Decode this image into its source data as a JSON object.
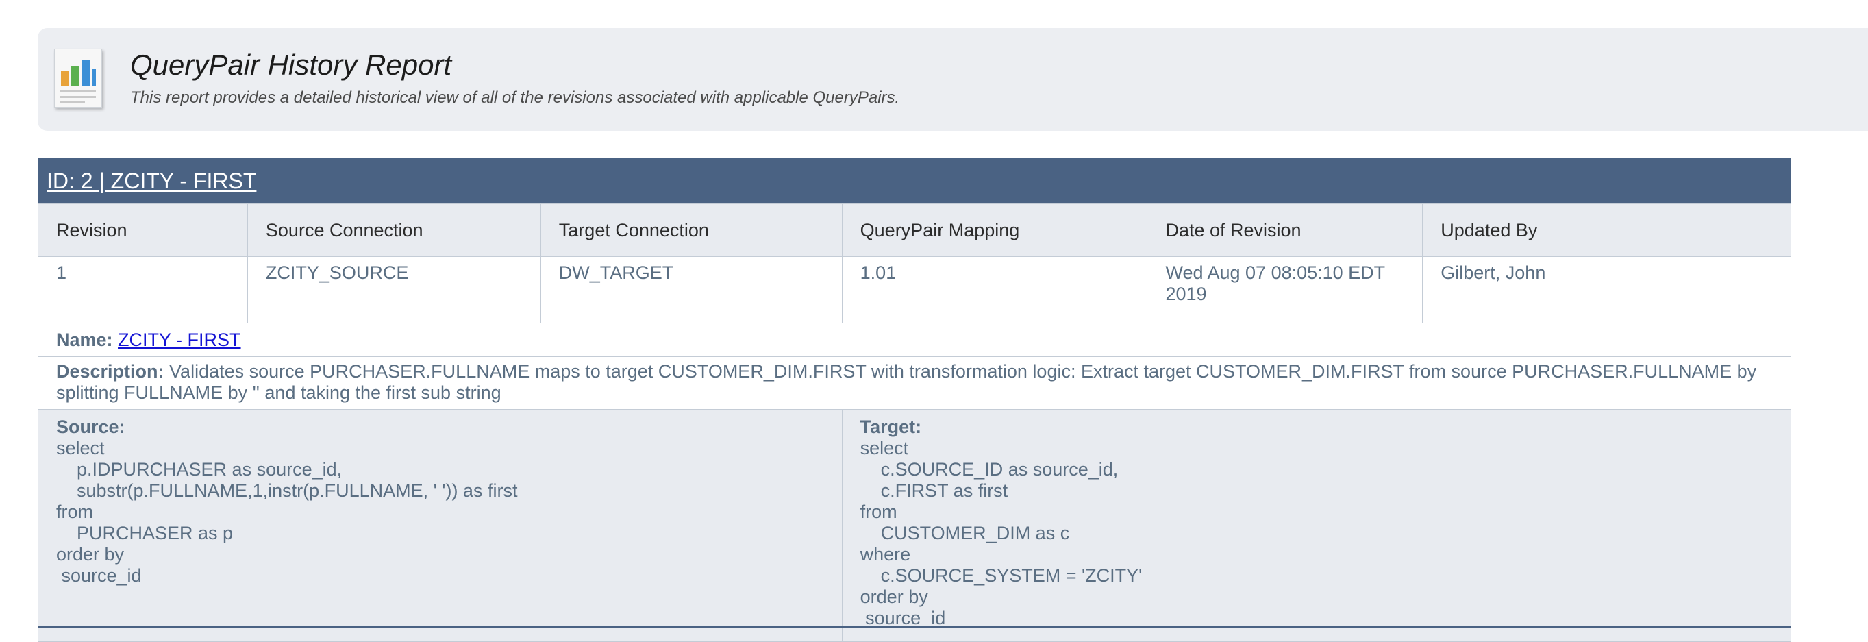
{
  "report": {
    "title": "QueryPair History Report",
    "subtitle": "This report provides a detailed historical view of all of the revisions associated with applicable QueryPairs."
  },
  "querypair": {
    "heading": "ID: 2 | ZCITY - FIRST",
    "columns": [
      "Revision",
      "Source Connection",
      "Target Connection",
      "QueryPair Mapping",
      "Date of Revision",
      "Updated By"
    ],
    "row": {
      "revision": "1",
      "source_connection": "ZCITY_SOURCE",
      "target_connection": "DW_TARGET",
      "mapping": "1.01",
      "date": "Wed Aug 07 08:05:10 EDT 2019",
      "updated_by": "Gilbert, John"
    },
    "name_label": "Name:",
    "name_value": "ZCITY - FIRST",
    "description_label": "Description:",
    "description_value": "Validates source PURCHASER.FULLNAME maps to target CUSTOMER_DIM.FIRST with transformation logic: Extract target CUSTOMER_DIM.FIRST from source PURCHASER.FULLNAME by splitting FULLNAME by '' and taking the first sub string",
    "source_label": "Source:",
    "source_sql": [
      "select",
      "    p.IDPURCHASER as source_id,",
      "    substr(p.FULLNAME,1,instr(p.FULLNAME, ' ')) as first",
      "from",
      "    PURCHASER as p",
      "order by",
      " source_id"
    ],
    "target_label": "Target:",
    "target_sql": [
      "select",
      "    c.SOURCE_ID as source_id,",
      "    c.FIRST as first",
      "from",
      "    CUSTOMER_DIM as c",
      "where",
      "    c.SOURCE_SYSTEM = 'ZCITY'",
      "order by",
      " source_id"
    ]
  },
  "colors": {
    "header_bar": "#4a6283",
    "banner_bg": "#eceef2",
    "table_header_bg": "#e8ebf0",
    "link": "#1414d4",
    "text": "#5a6e82"
  }
}
